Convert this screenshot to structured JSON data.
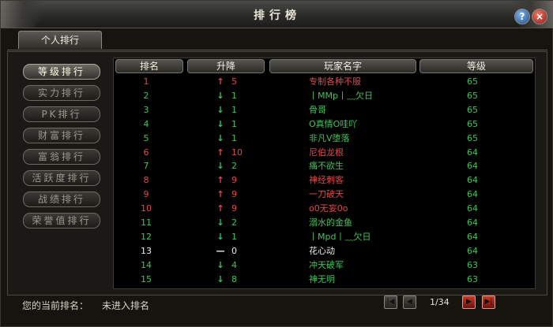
{
  "window": {
    "title": "排行榜",
    "help_glyph": "?",
    "close_glyph": "×"
  },
  "tabs": [
    {
      "label": "个人排行"
    }
  ],
  "sidebar": {
    "items": [
      {
        "label": "等级排行",
        "active": true
      },
      {
        "label": "实力排行",
        "active": false
      },
      {
        "label": "PK排行",
        "active": false
      },
      {
        "label": "财富排行",
        "active": false
      },
      {
        "label": "富翁排行",
        "active": false
      },
      {
        "label": "活跃度排行",
        "active": false
      },
      {
        "label": "战绩排行",
        "active": false
      },
      {
        "label": "荣誉值排行",
        "active": false
      }
    ]
  },
  "table": {
    "headers": {
      "rank": "排名",
      "change": "升降",
      "name": "玩家名字",
      "level": "等级"
    },
    "rows": [
      {
        "rank": "1",
        "dir": "up",
        "delta": "5",
        "name": "专制各种不服",
        "level": "65"
      },
      {
        "rank": "2",
        "dir": "down",
        "delta": "1",
        "name": "丨MMp丨﹏欠日",
        "level": "65"
      },
      {
        "rank": "3",
        "dir": "down",
        "delta": "1",
        "name": "骨哥",
        "level": "65"
      },
      {
        "rank": "4",
        "dir": "down",
        "delta": "1",
        "name": "O真情O哇吖",
        "level": "65"
      },
      {
        "rank": "5",
        "dir": "down",
        "delta": "1",
        "name": "非凡V堕落",
        "level": "65"
      },
      {
        "rank": "6",
        "dir": "up",
        "delta": "10",
        "name": "尼伯龙根",
        "level": "64"
      },
      {
        "rank": "7",
        "dir": "down",
        "delta": "2",
        "name": "痛不欲生",
        "level": "64"
      },
      {
        "rank": "8",
        "dir": "up",
        "delta": "9",
        "name": "神经刺客",
        "level": "64"
      },
      {
        "rank": "9",
        "dir": "up",
        "delta": "9",
        "name": "一刀破天",
        "level": "64"
      },
      {
        "rank": "10",
        "dir": "up",
        "delta": "9",
        "name": "o0无妄0o",
        "level": "64"
      },
      {
        "rank": "11",
        "dir": "down",
        "delta": "2",
        "name": "溺水的金鱼",
        "level": "64"
      },
      {
        "rank": "12",
        "dir": "down",
        "delta": "1",
        "name": "丨Mpd丨﹏欠日",
        "level": "64"
      },
      {
        "rank": "13",
        "dir": "same",
        "delta": "0",
        "name": "花心动",
        "level": "64"
      },
      {
        "rank": "14",
        "dir": "down",
        "delta": "4",
        "name": "冲天破军",
        "level": "63"
      },
      {
        "rank": "15",
        "dir": "down",
        "delta": "8",
        "name": "神无明",
        "level": "63"
      }
    ]
  },
  "arrows": {
    "up": "↑",
    "down": "↓",
    "same": "—"
  },
  "colors": {
    "up": "#e0484c",
    "down": "#3fc45a",
    "same": "#ececec",
    "level": "#3fc45a"
  },
  "footer": {
    "current_rank_label": "您的当前排名：",
    "current_rank_value": "未进入排名",
    "page_info": "1/34",
    "first_glyph": "|◀",
    "prev_glyph": "◀",
    "next_glyph": "▶",
    "last_glyph": "▶|"
  }
}
